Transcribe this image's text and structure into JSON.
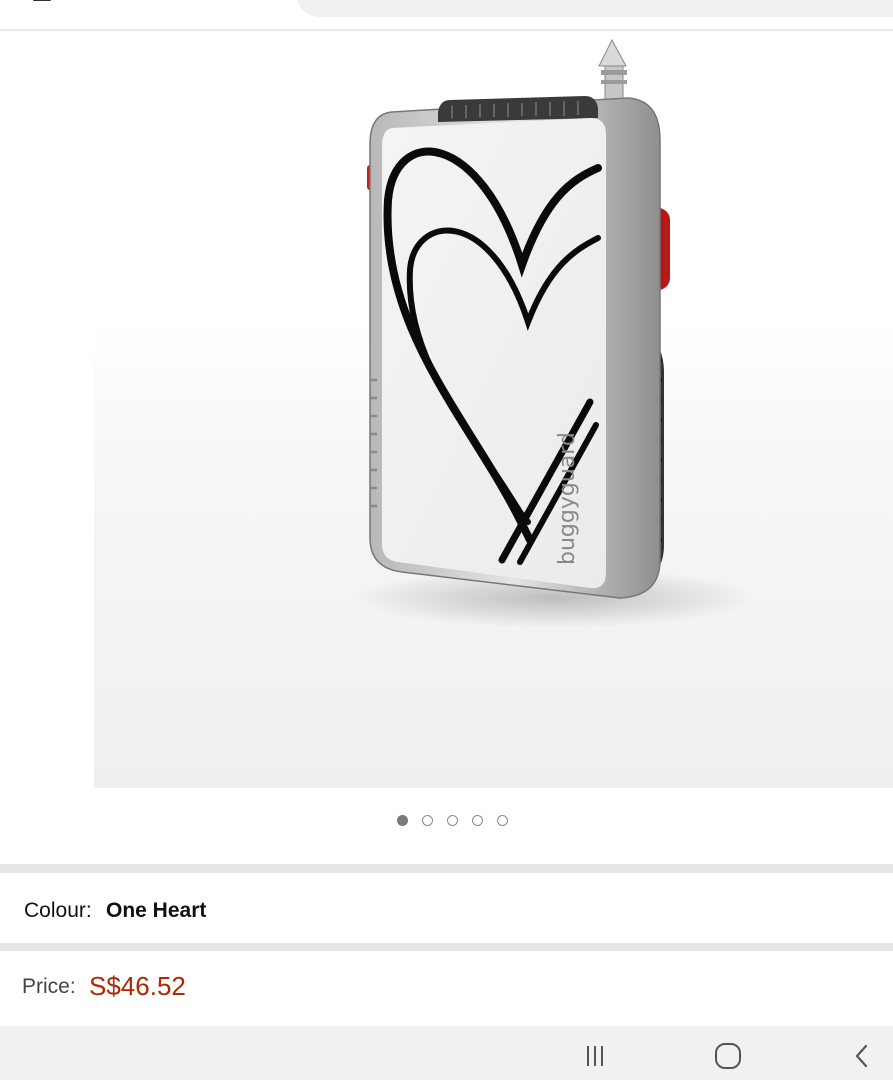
{
  "product": {
    "image_alt": "buggyguard",
    "image_brand_text": "buggyguard",
    "carousel": {
      "count": 5,
      "active_index": 0
    }
  },
  "variation": {
    "colour_label": "Colour:",
    "colour_value": "One Heart"
  },
  "pricing": {
    "price_label": "Price:",
    "price_value": "S$46.52",
    "price_color": "#b12704"
  },
  "navbar": {
    "recent_icon": "recent-apps-icon",
    "home_icon": "home-icon",
    "back_icon": "back-icon"
  }
}
